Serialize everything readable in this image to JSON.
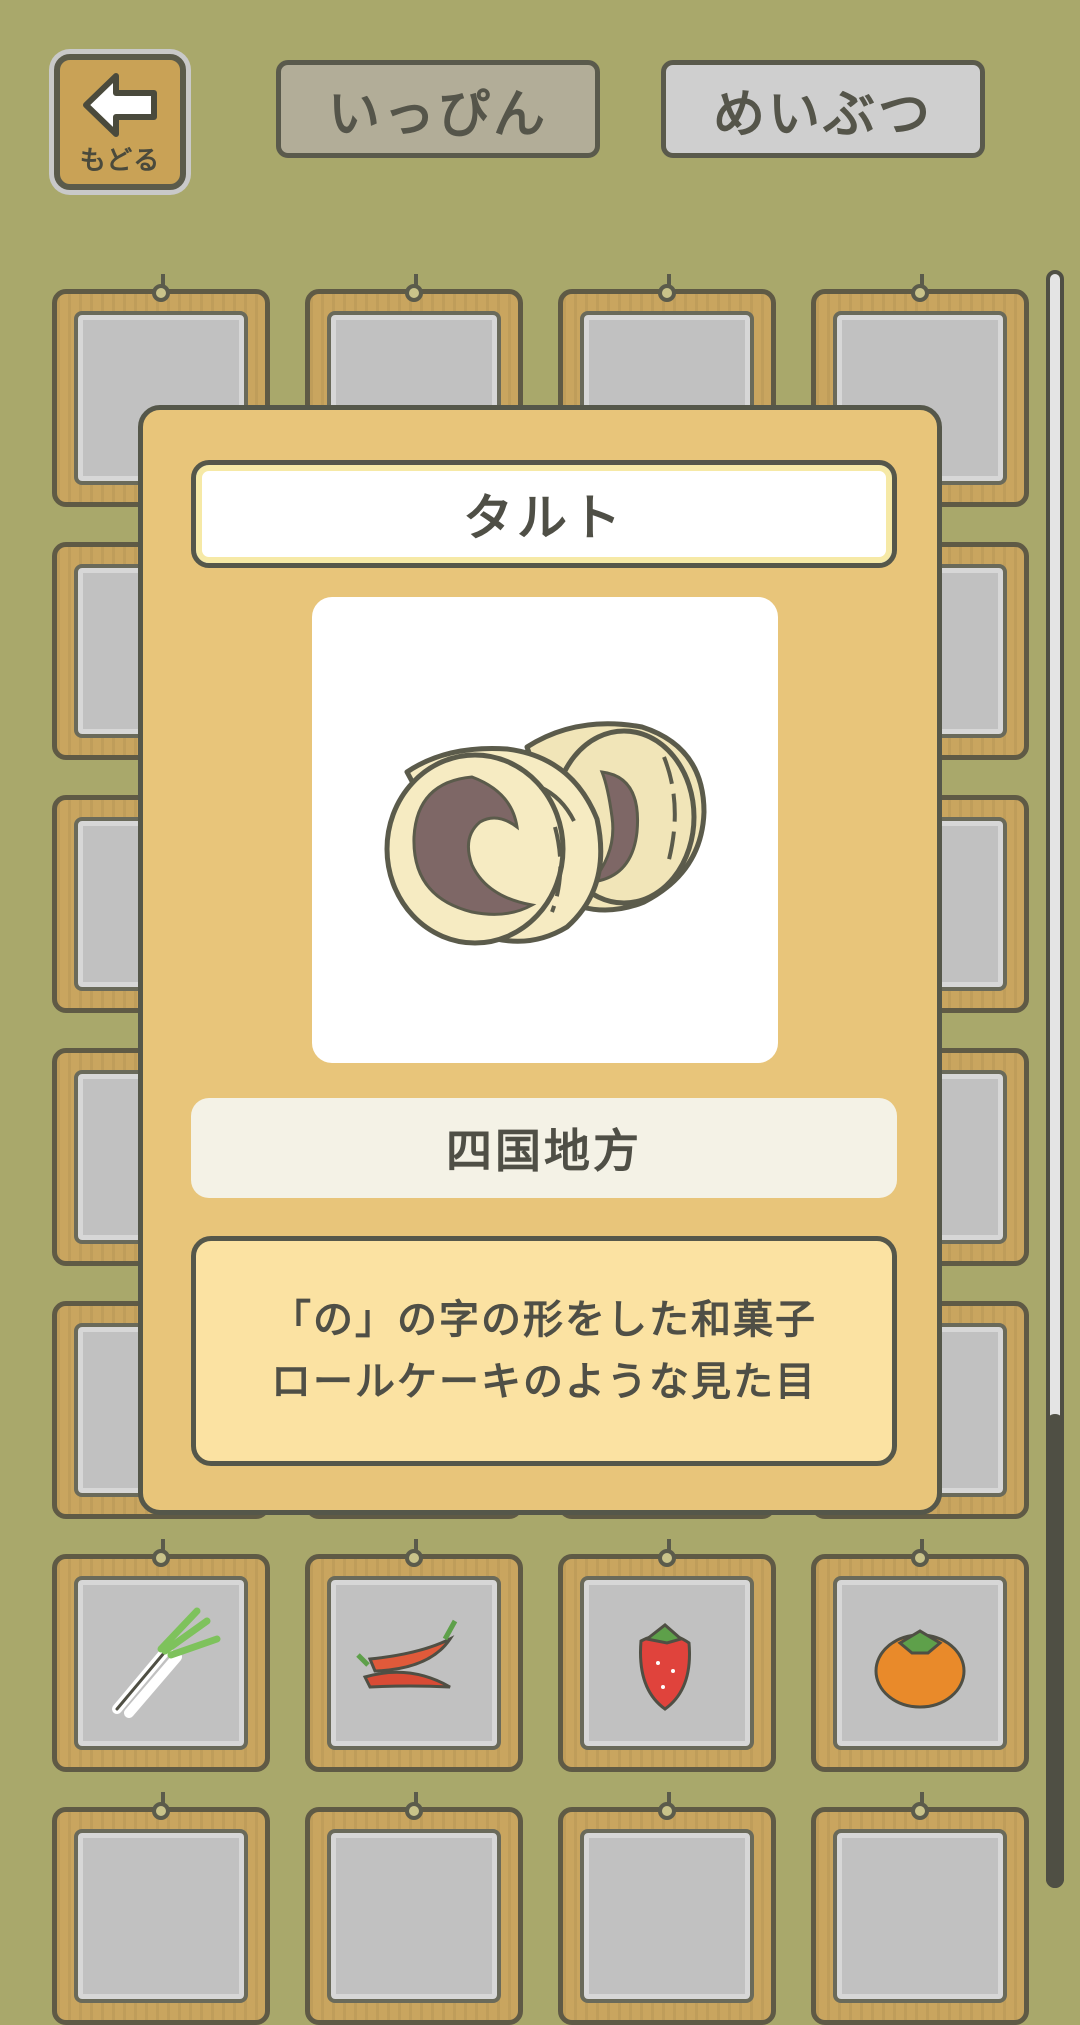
{
  "header": {
    "back_label": "もどる",
    "tabs": [
      {
        "label": "いっぴん",
        "selected": true
      },
      {
        "label": "めいぶつ",
        "selected": false
      }
    ]
  },
  "grid": {
    "rows_visible": 7,
    "columns": 4,
    "visible_bottom_row_items": [
      "green-onion",
      "red-chili-peppers",
      "strawberry",
      "persimmon"
    ]
  },
  "modal": {
    "title": "タルト",
    "item_icon": "tart-roll-cake",
    "region": "四国地方",
    "description_line1": "「の」の字の形をした和菓子",
    "description_line2": "ロールケーキのような見た目"
  },
  "colors": {
    "background": "#a9a86b",
    "modal_bg": "#e8c57a",
    "card_frame": "#c9a55f",
    "description_bg": "#fbe2a2"
  }
}
